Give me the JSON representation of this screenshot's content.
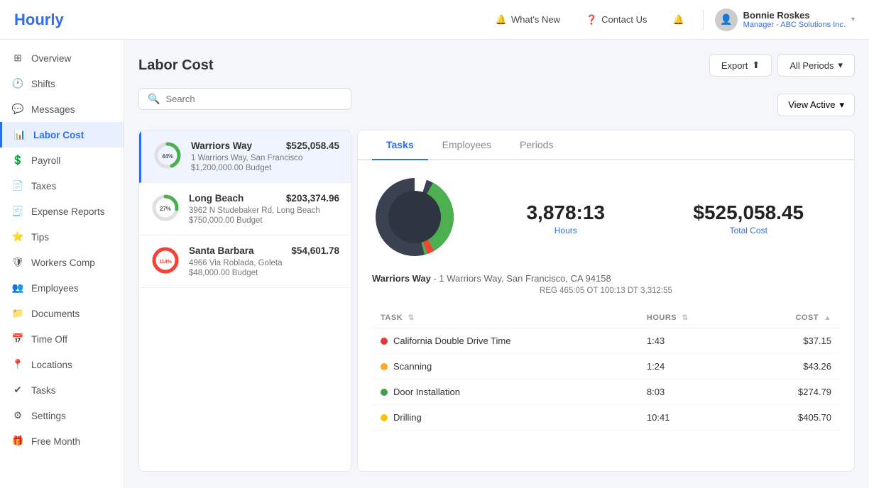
{
  "app": {
    "logo": "Hourly"
  },
  "header": {
    "whats_new_label": "What's New",
    "contact_us_label": "Contact Us",
    "user_name": "Bonnie Roskes",
    "user_role": "Manager - ABC Solutions Inc.",
    "export_label": "Export",
    "all_periods_label": "All Periods"
  },
  "sidebar": {
    "items": [
      {
        "id": "overview",
        "label": "Overview",
        "icon": "grid"
      },
      {
        "id": "shifts",
        "label": "Shifts",
        "icon": "clock"
      },
      {
        "id": "messages",
        "label": "Messages",
        "icon": "chat"
      },
      {
        "id": "labor-cost",
        "label": "Labor Cost",
        "icon": "bar-chart",
        "active": true
      },
      {
        "id": "payroll",
        "label": "Payroll",
        "icon": "dollar"
      },
      {
        "id": "taxes",
        "label": "Taxes",
        "icon": "file-tax"
      },
      {
        "id": "expense-reports",
        "label": "Expense Reports",
        "icon": "receipt"
      },
      {
        "id": "tips",
        "label": "Tips",
        "icon": "star"
      },
      {
        "id": "workers-comp",
        "label": "Workers Comp",
        "icon": "shield"
      },
      {
        "id": "employees",
        "label": "Employees",
        "icon": "people"
      },
      {
        "id": "documents",
        "label": "Documents",
        "icon": "doc"
      },
      {
        "id": "time-off",
        "label": "Time Off",
        "icon": "calendar"
      },
      {
        "id": "locations",
        "label": "Locations",
        "icon": "pin"
      },
      {
        "id": "tasks",
        "label": "Tasks",
        "icon": "check"
      },
      {
        "id": "settings",
        "label": "Settings",
        "icon": "gear"
      },
      {
        "id": "free-month",
        "label": "Free Month",
        "icon": "gift"
      }
    ]
  },
  "page": {
    "title": "Labor Cost",
    "search_placeholder": "Search",
    "view_active_label": "View Active"
  },
  "locations": [
    {
      "id": 1,
      "name": "Warriors Way",
      "address": "1 Warriors Way, San Francisco",
      "budget": "$1,200,000.00 Budget",
      "amount": "$525,058.45",
      "percent": 44,
      "active": true,
      "color_used": "#4caf50",
      "color_remaining": "#e0e0e0"
    },
    {
      "id": 2,
      "name": "Long Beach",
      "address": "3962 N Studebaker Rd, Long Beach",
      "budget": "$750,000.00 Budget",
      "amount": "$203,374.96",
      "percent": 27,
      "active": false,
      "color_used": "#4caf50",
      "color_remaining": "#e0e0e0"
    },
    {
      "id": 3,
      "name": "Santa Barbara",
      "address": "4966 Via Roblada, Goleta",
      "budget": "$48,000.00 Budget",
      "amount": "$54,601.78",
      "percent": 114,
      "active": false,
      "color_used": "#f44336",
      "color_remaining": "#e0e0e0"
    }
  ],
  "detail": {
    "location_name": "Warriors Way",
    "location_address": "1 Warriors Way, San Francisco, CA 94158",
    "hours": "3,878:13",
    "hours_label": "Hours",
    "total_cost": "$525,058.45",
    "total_cost_label": "Total Cost",
    "reg_detail": "REG 465:05 OT 100:13 DT 3,312:55",
    "tabs": [
      {
        "id": "tasks",
        "label": "Tasks",
        "active": true
      },
      {
        "id": "employees",
        "label": "Employees",
        "active": false
      },
      {
        "id": "periods",
        "label": "Periods",
        "active": false
      }
    ],
    "table": {
      "col_task": "TASK",
      "col_hours": "HOURS",
      "col_cost": "COST",
      "rows": [
        {
          "name": "California Double Drive Time",
          "hours": "1:43",
          "cost": "$37.15",
          "color": "#e53935"
        },
        {
          "name": "Scanning",
          "hours": "1:24",
          "cost": "$43.26",
          "color": "#ffa726"
        },
        {
          "name": "Door Installation",
          "hours": "8:03",
          "cost": "$274.79",
          "color": "#43a047"
        },
        {
          "name": "Drilling",
          "hours": "10:41",
          "cost": "$405.70",
          "color": "#ffc107"
        }
      ]
    }
  },
  "status": {
    "active_label": "Active"
  },
  "colors": {
    "brand": "#2d6df6",
    "donut_bg": "#2e3440",
    "donut_green": "#4caf50",
    "donut_red": "#f44336",
    "donut_white": "#ffffff"
  }
}
